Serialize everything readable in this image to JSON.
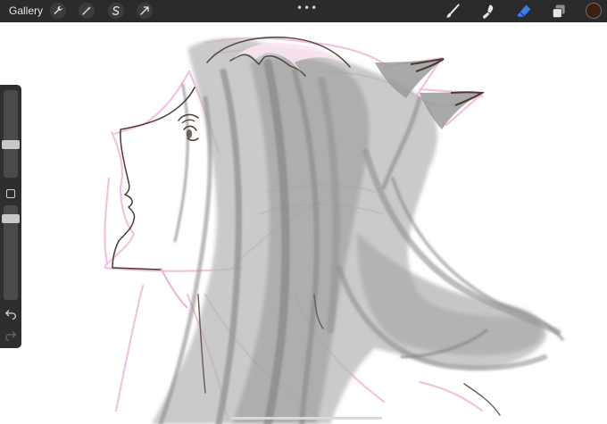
{
  "app": {
    "gallery_label": "Gallery",
    "more_label": "•••",
    "accent": "#3b7bf0",
    "current_color": "#3d1f0f"
  },
  "toolbar_left": [
    {
      "icon": "wrench-icon",
      "name": "actions-button"
    },
    {
      "icon": "magic-wand-icon",
      "name": "adjustments-button"
    },
    {
      "icon": "selection-s-icon",
      "name": "selection-button"
    },
    {
      "icon": "transform-arrow-icon",
      "name": "transform-button"
    }
  ],
  "toolbar_right": [
    {
      "icon": "brush-icon",
      "name": "brush-tool"
    },
    {
      "icon": "smudge-icon",
      "name": "smudge-tool"
    },
    {
      "icon": "eraser-icon",
      "name": "eraser-tool",
      "active": true
    },
    {
      "icon": "layers-icon",
      "name": "layers-button"
    }
  ],
  "sidebar": {
    "brush_size_level": 0.32,
    "opacity_level": 0.74,
    "undo_icon": "undo-icon",
    "redo_icon": "redo-icon"
  }
}
